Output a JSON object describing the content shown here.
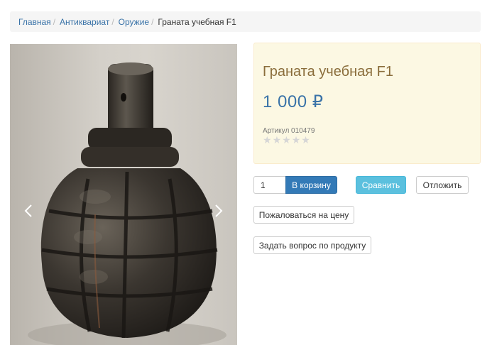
{
  "breadcrumb": {
    "items": [
      "Главная",
      "Антиквариат",
      "Оружие"
    ],
    "separator": "/",
    "current": "Граната учебная F1"
  },
  "gallery": {
    "image": "grenade-photo",
    "prev_icon": "chevron-left-icon",
    "next_icon": "chevron-right-icon"
  },
  "product": {
    "title": "Граната учебная F1",
    "price": "1 000 ₽",
    "sku": "Артикул 010479",
    "rating": {
      "stars": 5,
      "filled": 0
    }
  },
  "actions": {
    "quantity": "1",
    "add_to_cart": "В корзину",
    "compare": "Сравнить",
    "defer": "Отложить",
    "complain_price": "Пожаловаться на цену",
    "ask_question": "Задать вопрос по продукту"
  },
  "colors": {
    "link": "#3a73a8",
    "primary": "#337ab7",
    "info": "#5bc0de",
    "warning_bg": "#fcf8e3",
    "title_text": "#8a6d3b"
  }
}
